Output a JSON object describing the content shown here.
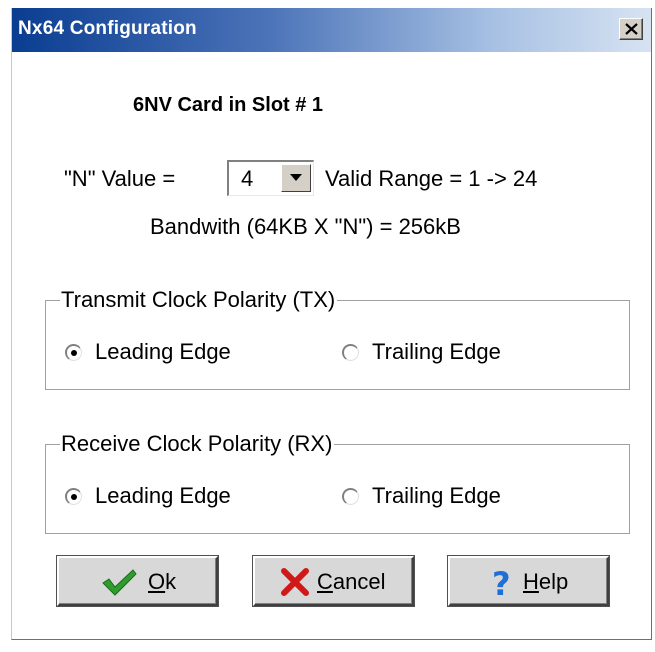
{
  "window": {
    "title": "Nx64 Configuration",
    "close_glyph": "✕"
  },
  "heading": "6NV Card in Slot # 1",
  "n_value": {
    "label": "\"N\" Value =",
    "selected": "4",
    "valid_range": "Valid Range = 1 -> 24"
  },
  "bandwidth": "Bandwith (64KB X \"N\") =  256kB",
  "tx_group": {
    "legend": "Transmit Clock Polarity (TX)",
    "options": [
      {
        "label": "Leading Edge",
        "checked": true
      },
      {
        "label": "Trailing Edge",
        "checked": false
      }
    ]
  },
  "rx_group": {
    "legend": "Receive Clock Polarity (RX)",
    "options": [
      {
        "label": "Leading Edge",
        "checked": true
      },
      {
        "label": "Trailing Edge",
        "checked": false
      }
    ]
  },
  "buttons": {
    "ok": {
      "mnemonic": "O",
      "rest": "k",
      "icon": "checkmark-icon",
      "color": "#2e9d2e"
    },
    "cancel": {
      "mnemonic": "C",
      "rest": "ancel",
      "icon": "x-mark-icon",
      "color": "#d01818"
    },
    "help": {
      "mnemonic": "H",
      "rest": "elp",
      "icon": "question-mark-icon",
      "color": "#1f6fd6"
    }
  }
}
